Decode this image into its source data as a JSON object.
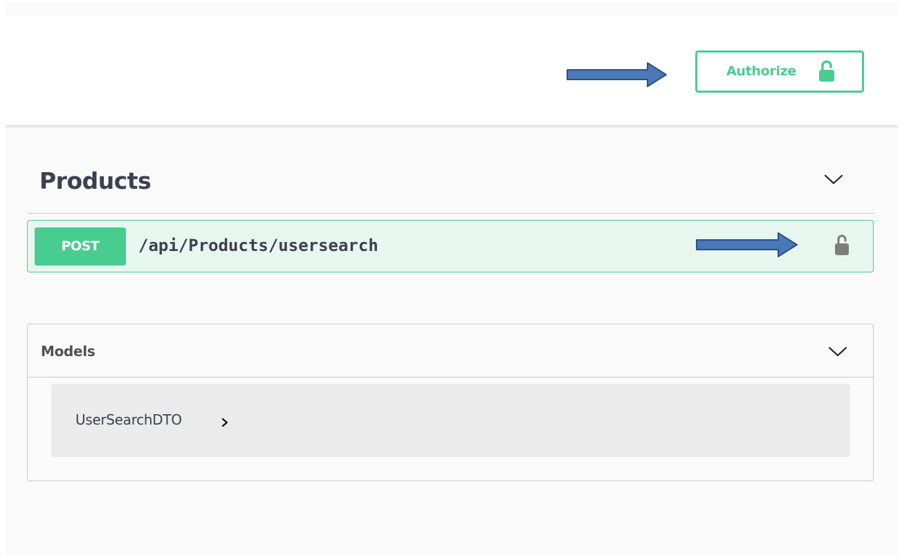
{
  "header": {
    "authorize_label": "Authorize",
    "authorize_icon": "unlocked-padlock-icon",
    "accent_color": "#49cc90",
    "annotation_arrow_color": "#4a78b9"
  },
  "section": {
    "title": "Products",
    "toggle_icon": "chevron-down-icon"
  },
  "operation": {
    "method": "POST",
    "path": "/api/Products/usersearch",
    "lock_icon": "unlocked-padlock-icon",
    "method_color": "#49cc90",
    "background_color": "#e8f6f0"
  },
  "models": {
    "title": "Models",
    "toggle_icon": "chevron-down-icon",
    "items": [
      {
        "name": "UserSearchDTO",
        "expand_icon": "chevron-right-icon"
      }
    ]
  }
}
